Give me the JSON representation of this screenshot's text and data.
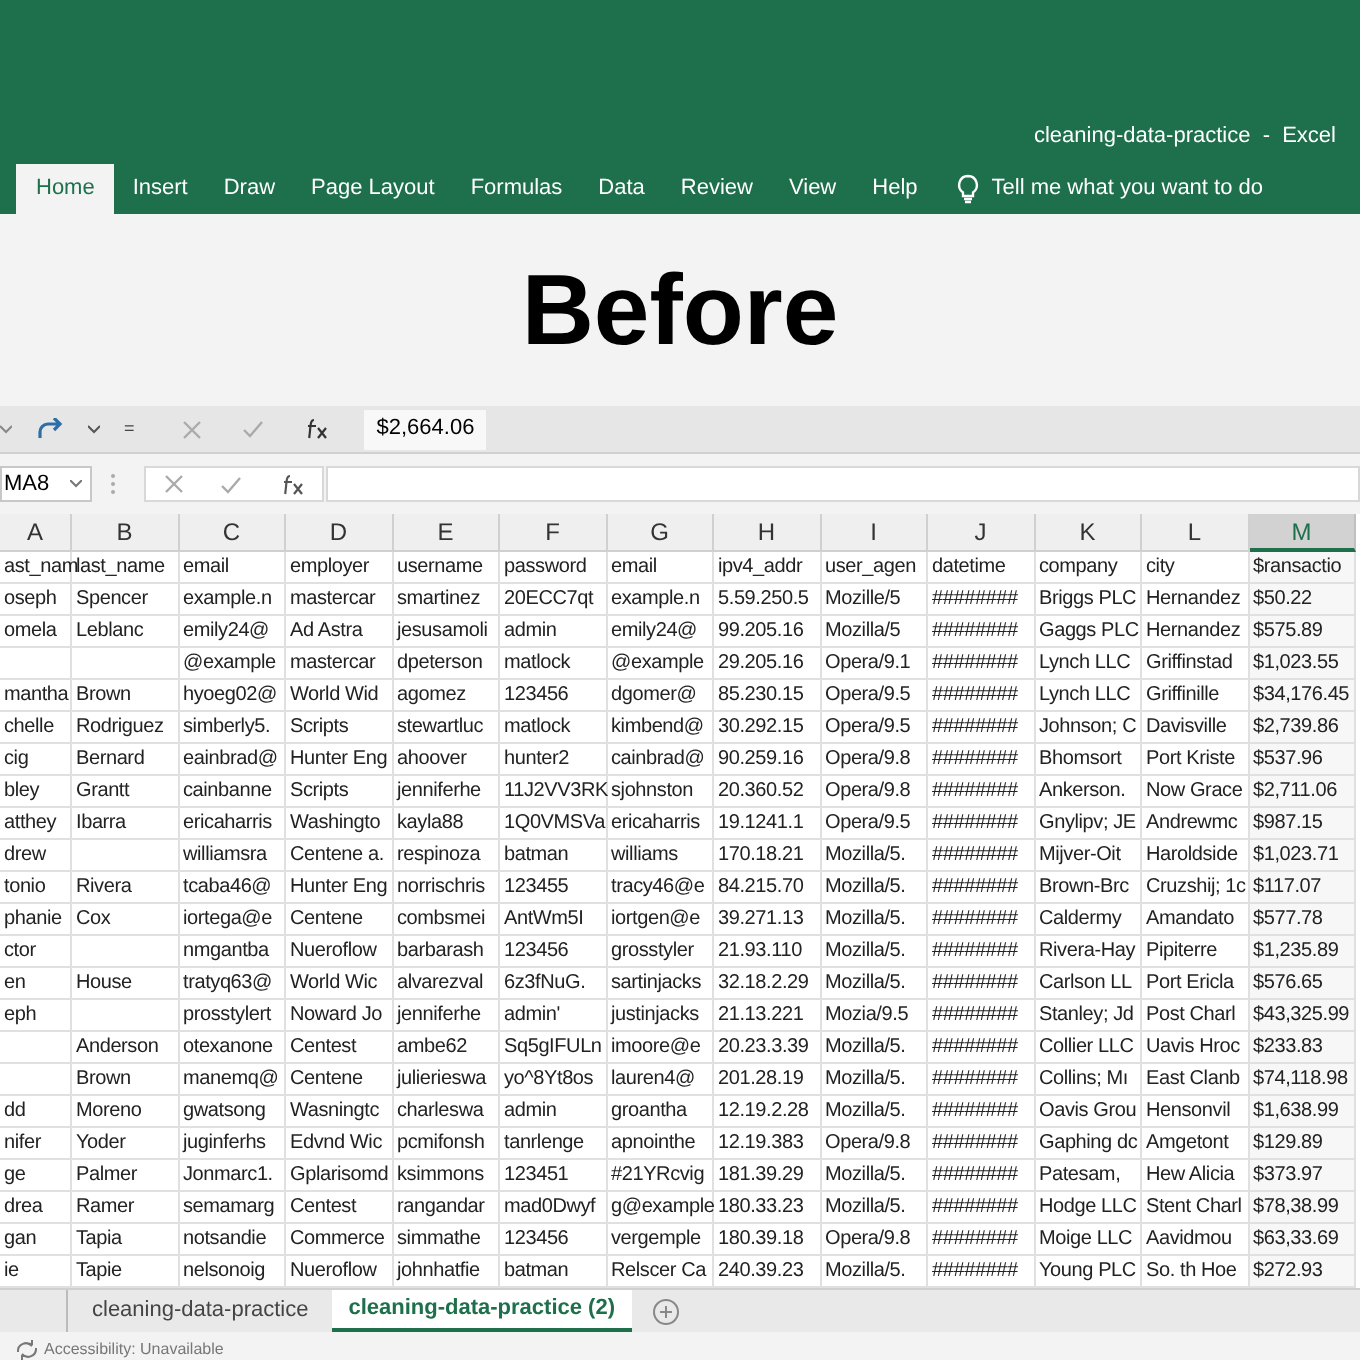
{
  "window": {
    "title": "cleaning-data-practice  -  Excel"
  },
  "ribbon_tabs": [
    {
      "label": "Home",
      "selected": true
    },
    {
      "label": "Insert",
      "selected": false
    },
    {
      "label": "Draw",
      "selected": false
    },
    {
      "label": "Page Layout",
      "selected": false
    },
    {
      "label": "Formulas",
      "selected": false
    },
    {
      "label": "Data",
      "selected": false
    },
    {
      "label": "Review",
      "selected": false
    },
    {
      "label": "View",
      "selected": false
    },
    {
      "label": "Help",
      "selected": false
    }
  ],
  "tell_me": "Tell me what you want to do",
  "overlay_heading": "Before",
  "quick_access": {
    "customize": "=",
    "formula_value": "$2,664.06"
  },
  "formula_bar": {
    "name_box": "MA8"
  },
  "columns": [
    {
      "label": "A",
      "selected": false
    },
    {
      "label": "B",
      "selected": false
    },
    {
      "label": "C",
      "selected": false
    },
    {
      "label": "D",
      "selected": false
    },
    {
      "label": "E",
      "selected": false
    },
    {
      "label": "F",
      "selected": false
    },
    {
      "label": "G",
      "selected": false
    },
    {
      "label": "H",
      "selected": false
    },
    {
      "label": "I",
      "selected": false
    },
    {
      "label": "J",
      "selected": false
    },
    {
      "label": "K",
      "selected": false
    },
    {
      "label": "L",
      "selected": false
    },
    {
      "label": "M",
      "selected": true
    }
  ],
  "rows": [
    [
      "ast_nam",
      "last_name",
      "email",
      "employer",
      "username",
      "password",
      "email",
      "ipv4_addr",
      "user_agen",
      "datetime",
      "company",
      "city",
      "$ransactio"
    ],
    [
      "oseph",
      "Spencer",
      "example.n",
      "mastercar",
      "smartinez",
      "20ECC7qt",
      "example.n",
      "5.59.250.5",
      "Mozille/5",
      "########",
      "Briggs PLC",
      "Hernandez",
      "$50.22"
    ],
    [
      "omela",
      "Leblanc",
      "emily24@",
      "Ad Astra",
      "jesusamoli",
      "admin",
      "emily24@",
      "99.205.16",
      "Mozilla/5",
      "########",
      "Gaggs PLC",
      "Hernandez",
      "$575.89"
    ],
    [
      "",
      "",
      "@example",
      "mastercar",
      "dpeterson",
      "matlock",
      "@example",
      "29.205.16",
      "Opera/9.1",
      "########",
      "Lynch LLC",
      "Griffinstad",
      "$1,023.55"
    ],
    [
      "mantha",
      "Brown",
      "hyoeg02@",
      "World Wid",
      "agomez",
      "123456",
      "dgomer@",
      "85.230.15",
      "Opera/9.5",
      "########",
      "Lynch LLC",
      "Griffinille",
      "$34,176.45"
    ],
    [
      "chelle",
      "Rodriguez",
      "simberly5.",
      "Scripts",
      "stewartluc",
      "matlock",
      "kimbend@",
      "30.292.15",
      "Opera/9.5",
      "########",
      "Johnson; C",
      "Davisville",
      "$2,739.86"
    ],
    [
      "cig",
      "Bernard",
      "eainbrad@",
      "Hunter Eng",
      "ahoover",
      "hunter2",
      "cainbrad@",
      "90.259.16",
      "Opera/9.8",
      "########",
      "Bhomsort",
      "Port Kriste",
      "$537.96"
    ],
    [
      "bley",
      "Grantt",
      "cainbanne",
      "Scripts",
      "jenniferhe",
      "11J2VV3RK",
      "sjohnston",
      "20.360.52",
      "Opera/9.8",
      "########",
      "Ankerson.",
      "Now Grace",
      "$2,711.06"
    ],
    [
      "atthey",
      "Ibarra",
      "ericaharris",
      "Washingto",
      "kayla88",
      "1Q0VMSVa",
      "ericaharris",
      "19.1241.1",
      "Opera/9.5",
      "########",
      "Gnylipv; JE",
      "Andrewmc",
      "$987.15"
    ],
    [
      "drew",
      "",
      "williamsra",
      "Centene a.",
      "respinoza",
      "batman",
      "williams",
      "170.18.21",
      "Mozilla/5.",
      "########",
      "Mijver-Oit",
      "Haroldside",
      "$1,023.71"
    ],
    [
      "tonio",
      "Rivera",
      "tcaba46@",
      "Hunter Eng",
      "norrischris",
      "123455",
      "tracy46@e",
      "84.215.70",
      "Mozilla/5.",
      "########",
      "Brown-Brc",
      "Cruzshij; 1c",
      "$117.07"
    ],
    [
      "phanie",
      "Cox",
      "iortega@e",
      "Centene",
      "combsmei",
      "AntWm5I",
      "iortgen@e",
      "39.271.13",
      "Mozilla/5.",
      "########",
      "Caldermy",
      "Amandato",
      "$577.78"
    ],
    [
      "ctor",
      "",
      "nmgantba",
      "Nueroflow",
      "barbarash",
      "123456",
      "grosstyler",
      "21.93.110",
      "Mozilla/5.",
      "########",
      "Rivera-Hay",
      "Pipiterre",
      "$1,235.89"
    ],
    [
      "en",
      "House",
      "tratyq63@",
      "World Wic",
      "alvarezval",
      "6z3fNuG.",
      "sartinjacks",
      "32.18.2.29",
      "Mozilla/5.",
      "########",
      "Carlson LL",
      "Port Ericla",
      "$576.65"
    ],
    [
      "eph",
      "",
      "prosstylert",
      "Noward Jo",
      "jenniferhe",
      "admin'",
      "justinjacks",
      "21.13.221",
      "Mozia/9.5",
      "########",
      "Stanley; Jd",
      "Post Charl",
      "$43,325.99"
    ],
    [
      "",
      "Anderson",
      "otexanone",
      "Centest",
      "ambe62",
      "Sq5gIFULn",
      "imoore@e",
      "20.23.3.39",
      "Mozilla/5.",
      "########",
      "Collier LLC",
      "Uavis Hroc",
      "$233.83"
    ],
    [
      "",
      "Brown",
      "manemq@",
      "Centene",
      "julierieswa",
      "yo^8Yt8os",
      "lauren4@",
      "201.28.19",
      "Mozilla/5.",
      "########",
      "Collins; Mı",
      "East Clanb",
      "$74,118.98"
    ],
    [
      "dd",
      "Moreno",
      "gwatsong",
      "Wasningtc",
      "charleswa",
      "admin",
      "groantha",
      "12.19.2.28",
      "Mozilla/5.",
      "########",
      "Oavis Grou",
      "Hensonvil",
      "$1,638.99"
    ],
    [
      "nifer",
      "Yoder",
      "juginferhs",
      "Edvnd Wic",
      "pcmifonsh",
      "tanrlenge",
      "apnointhe",
      "12.19.383",
      "Opera/9.8",
      "########",
      "Gaphing dc",
      "Amgetont",
      "$129.89"
    ],
    [
      "ge",
      "Palmer",
      "Jonmarc1.",
      "Gplarisomd",
      "ksimmons",
      "123451",
      "#21YRcvig",
      "181.39.29",
      "Mozilla/5.",
      "########",
      "Patesam,",
      "Hew Alicia",
      "$373.97"
    ],
    [
      "drea",
      "Ramer",
      "semamarg",
      "Centest",
      "rangandar",
      "mad0Dwyf",
      "g@example",
      "180.33.23",
      "Mozilla/5.",
      "########",
      "Hodge LLC",
      "Stent Charl",
      "$78,38.99"
    ],
    [
      "gan",
      "Tapia",
      "notsandie",
      "Commerce",
      "simmathe",
      "123456",
      "vergemple",
      "180.39.18",
      "Opera/9.8",
      "########",
      "Moige LLC",
      "Aavidmou",
      "$63,33.69"
    ],
    [
      "ie",
      "Tapie",
      "nelsonoig",
      "Nueroflow",
      "johnhatfie",
      "batman",
      "Relscer Ca",
      "240.39.23",
      "Mozilla/5.",
      "########",
      "Young PLC",
      "So. th Hoe",
      "$272.93"
    ]
  ],
  "sheet_tabs": [
    {
      "label": "cleaning-data-practice",
      "selected": false
    },
    {
      "label": "cleaning-data-practice (2)",
      "selected": true
    }
  ],
  "status_bar": {
    "accessibility": "Accessibility: Unavailable"
  }
}
